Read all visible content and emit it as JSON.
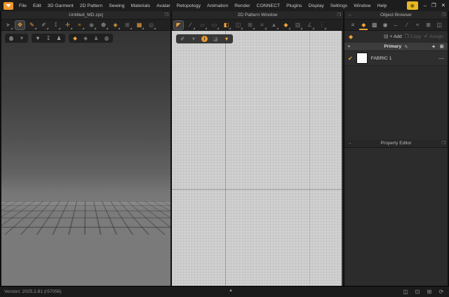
{
  "colors": {
    "accent": "#f0a43c",
    "panel": "#2b2b2b",
    "viewport2d_bg": "#d0d0d0",
    "logo_orange": "#ef962c",
    "badge_gold": "#e6b823"
  },
  "menubar": {
    "items": [
      "File",
      "Edit",
      "3D Garment",
      "2D Pattern",
      "Sewing",
      "Materials",
      "Avatar",
      "Retopology",
      "Animation",
      "Render",
      "CONNECT",
      "Plugins",
      "Display",
      "Settings",
      "Window",
      "Help"
    ],
    "controls": [
      {
        "n": "minimize-button",
        "g": "–",
        "c": "light"
      },
      {
        "n": "restore-button",
        "g": "❐",
        "c": "light"
      },
      {
        "n": "close-button",
        "g": "✕",
        "c": "light"
      }
    ]
  },
  "garment3d": {
    "title": "Untitled_MD.zprj",
    "tools": [
      {
        "n": "select-tool-icon",
        "g": "➤",
        "c": "dim",
        "caret": true
      },
      {
        "n": "move-tool-icon",
        "g": "✥",
        "c": "orange",
        "a": true
      },
      {
        "n": "pen-3d-tool-icon",
        "g": "✎",
        "c": "orange",
        "caret": true
      },
      {
        "n": "edit-sewing-tool-icon",
        "g": "✐",
        "c": "gray",
        "caret": true
      },
      {
        "n": "pin-tool-icon",
        "g": "↧",
        "c": "dim",
        "caret": true
      },
      {
        "n": "tack-tool-icon",
        "g": "✛",
        "c": "orange",
        "caret": true
      },
      {
        "n": "sewing-tool-icon",
        "g": "≈",
        "c": "orange",
        "caret": true
      },
      {
        "n": "steam-brush-icon",
        "g": "◉",
        "c": "dim",
        "caret": true
      },
      {
        "n": "avatar-tool-icon",
        "g": "⬟",
        "c": "dim",
        "caret": true
      },
      {
        "n": "flatten-tool-icon",
        "g": "◈",
        "c": "orange",
        "caret": true
      },
      {
        "n": "grid-tool-icon",
        "g": "⊞",
        "c": "dim",
        "caret": true
      },
      {
        "n": "remesh-tool-icon",
        "g": "▦",
        "c": "orange",
        "caret": true
      },
      {
        "n": "fur-tool-icon",
        "g": "◎",
        "c": "dim",
        "caret": true
      }
    ],
    "overlay": [
      [
        {
          "n": "show-3d-garment-icon",
          "g": "◍",
          "c": "light"
        },
        {
          "n": "show-3d-pattern-icon",
          "g": "▼",
          "c": "dim"
        }
      ],
      [
        {
          "n": "show-garment-icon",
          "g": "▼",
          "c": "gray"
        },
        {
          "n": "show-pin-icon",
          "g": "↧",
          "c": "gray"
        },
        {
          "n": "show-avatar-icon",
          "g": "♟",
          "c": "gray"
        }
      ],
      [
        {
          "n": "fabric-render-icon",
          "g": "◆",
          "c": "orange"
        },
        {
          "n": "fabric-mesh-icon",
          "g": "◆",
          "c": "dim"
        },
        {
          "n": "avatar-render-icon",
          "g": "♟",
          "c": "dim"
        },
        {
          "n": "world-render-icon",
          "g": "◍",
          "c": "gray"
        }
      ]
    ]
  },
  "pattern2d": {
    "title": "2D Pattern Window",
    "tools": [
      {
        "n": "transform-pattern-tool-icon",
        "g": "◤",
        "c": "orange",
        "a": true
      },
      {
        "n": "edit-pattern-tool-icon",
        "g": "∕",
        "c": "gray",
        "caret": true
      },
      {
        "n": "polygon-tool-icon",
        "g": "▱",
        "c": "dim",
        "caret": true
      },
      {
        "n": "rectangle-tool-icon",
        "g": "▭",
        "c": "dim",
        "caret": true
      },
      {
        "n": "dart-tool-icon",
        "g": "◧",
        "c": "orange",
        "caret": true
      },
      {
        "n": "notch-tool-icon",
        "g": "◫",
        "c": "dim",
        "caret": true
      },
      {
        "n": "grading-tool-icon",
        "g": "⊞",
        "c": "dim",
        "caret": true
      },
      {
        "n": "pleat-tool-icon",
        "g": "≡",
        "c": "dim",
        "caret": true
      },
      {
        "n": "trace-tool-icon",
        "g": "▲",
        "c": "dim",
        "caret": true
      },
      {
        "n": "texture-tool-icon",
        "g": "◆",
        "c": "orange",
        "caret": true
      },
      {
        "n": "baseline-tool-icon",
        "g": "▥",
        "c": "dim",
        "caret": true
      },
      {
        "n": "measure-tool-icon",
        "g": "∠",
        "c": "dim",
        "caret": true
      },
      {
        "n": "binding-tool-icon",
        "g": "⋮",
        "c": "dim",
        "caret": true
      }
    ],
    "overlay": [
      {
        "n": "pen-2d-icon",
        "g": "✐",
        "c": "gray"
      },
      {
        "n": "show-pattern-icon",
        "g": "▼",
        "c": "dim"
      },
      {
        "n": "pattern-info-icon",
        "g": "i",
        "c": "orange",
        "cls": "info-circle"
      },
      {
        "n": "show-fabric-icon",
        "g": "◪",
        "c": "dim"
      },
      {
        "n": "show-texture-icon",
        "g": "▼",
        "c": "orange"
      }
    ]
  },
  "object_browser": {
    "title": "Object Browser",
    "tabs": [
      {
        "n": "tab-scene",
        "g": "≡"
      },
      {
        "n": "tab-fabric",
        "g": "◆",
        "a": true
      },
      {
        "n": "tab-graphic",
        "g": "▩"
      },
      {
        "n": "tab-button",
        "g": "◉"
      },
      {
        "n": "tab-zipper",
        "g": "←"
      },
      {
        "n": "tab-topstitch",
        "g": "∕"
      },
      {
        "n": "tab-puckering",
        "g": "≈"
      },
      {
        "n": "tab-rack",
        "g": "⊞"
      },
      {
        "n": "tab-trim",
        "g": "◫"
      }
    ],
    "actions": {
      "add_label": "+ Add",
      "copy_label": "Copy",
      "assign_label": "Assign"
    },
    "section_label": "Primary",
    "items": [
      {
        "label": "FABRIC 1",
        "checked": true
      }
    ]
  },
  "property_editor": {
    "title": "Property Editor"
  },
  "statusbar": {
    "version": "Version: 2025.2.81 (r57056)",
    "right_icons": [
      {
        "n": "dual-view-icon",
        "g": "◫"
      },
      {
        "n": "window-3d-icon",
        "g": "⊡"
      },
      {
        "n": "window-2d-icon",
        "g": "⊞"
      },
      {
        "n": "reset-layout-icon",
        "g": "⟳"
      }
    ]
  }
}
